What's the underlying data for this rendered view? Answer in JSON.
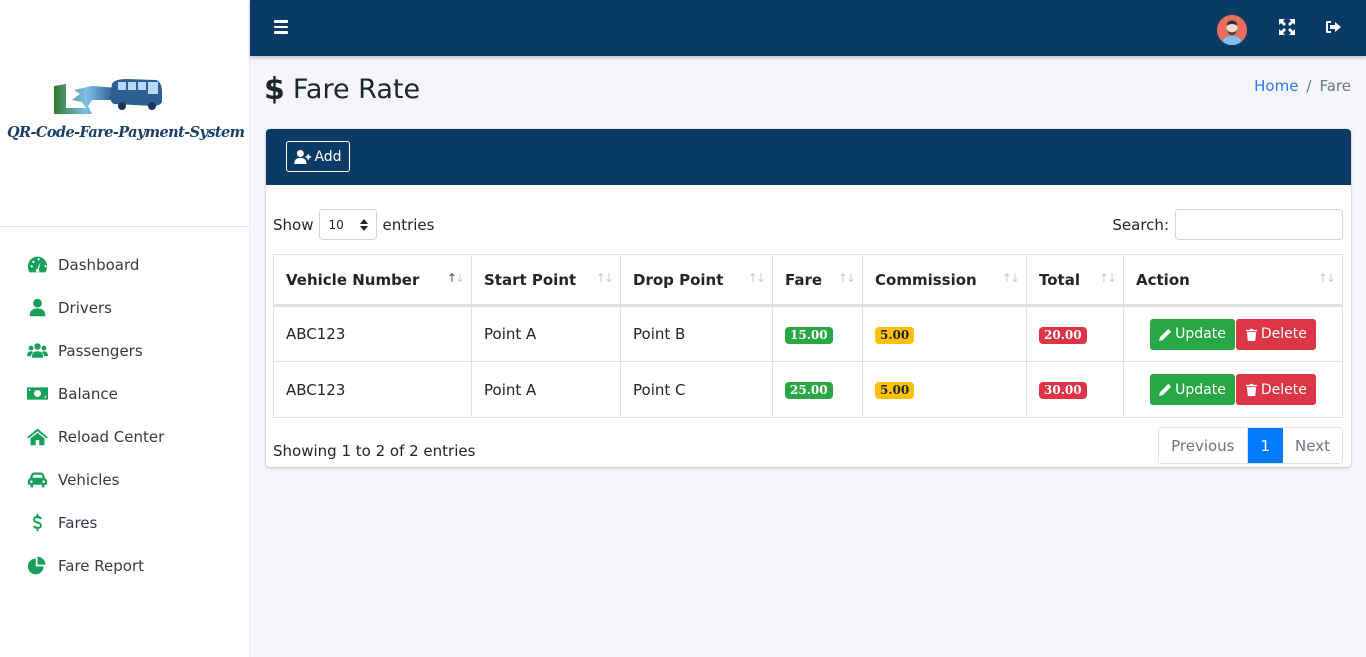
{
  "brand": {
    "name": "QR-Code-Fare-Payment-System",
    "logo_icon": "bus-road-logo"
  },
  "sidebar": {
    "items": [
      {
        "label": "Dashboard",
        "icon": "tachometer-icon"
      },
      {
        "label": "Drivers",
        "icon": "user-icon"
      },
      {
        "label": "Passengers",
        "icon": "users-icon"
      },
      {
        "label": "Balance",
        "icon": "money-bill-icon"
      },
      {
        "label": "Reload Center",
        "icon": "home-icon"
      },
      {
        "label": "Vehicles",
        "icon": "car-icon"
      },
      {
        "label": "Fares",
        "icon": "dollar-icon"
      },
      {
        "label": "Fare Report",
        "icon": "pie-chart-icon"
      }
    ]
  },
  "topbar": {
    "menu_icon": "bars-icon",
    "avatar": "user-avatar",
    "fullscreen_icon": "expand-icon",
    "logout_icon": "sign-out-icon"
  },
  "page": {
    "title_icon": "$",
    "title": "Fare Rate",
    "breadcrumb": {
      "home": "Home",
      "separator": "/",
      "current": "Fare"
    }
  },
  "card": {
    "add_label": "Add",
    "show_label": "Show",
    "entries_label": "entries",
    "page_length": "10",
    "search_label": "Search:",
    "search_value": "",
    "columns": [
      "Vehicle Number",
      "Start Point",
      "Drop Point",
      "Fare",
      "Commission",
      "Total",
      "Action"
    ],
    "rows": [
      {
        "vehicle": "ABC123",
        "start": "Point A",
        "drop": "Point B",
        "fare": "15.00",
        "commission": "5.00",
        "total": "20.00"
      },
      {
        "vehicle": "ABC123",
        "start": "Point A",
        "drop": "Point C",
        "fare": "25.00",
        "commission": "5.00",
        "total": "30.00"
      }
    ],
    "update_label": "Update",
    "delete_label": "Delete",
    "info": "Showing 1 to 2 of 2 entries",
    "pagination": {
      "previous": "Previous",
      "current": "1",
      "next": "Next"
    }
  },
  "colors": {
    "primary_dark": "#093b66",
    "accent_green": "#16a05a",
    "success": "#28a745",
    "warning": "#ffc107",
    "danger": "#dc3545",
    "link": "#2c7be5",
    "page_active": "#007bff"
  }
}
